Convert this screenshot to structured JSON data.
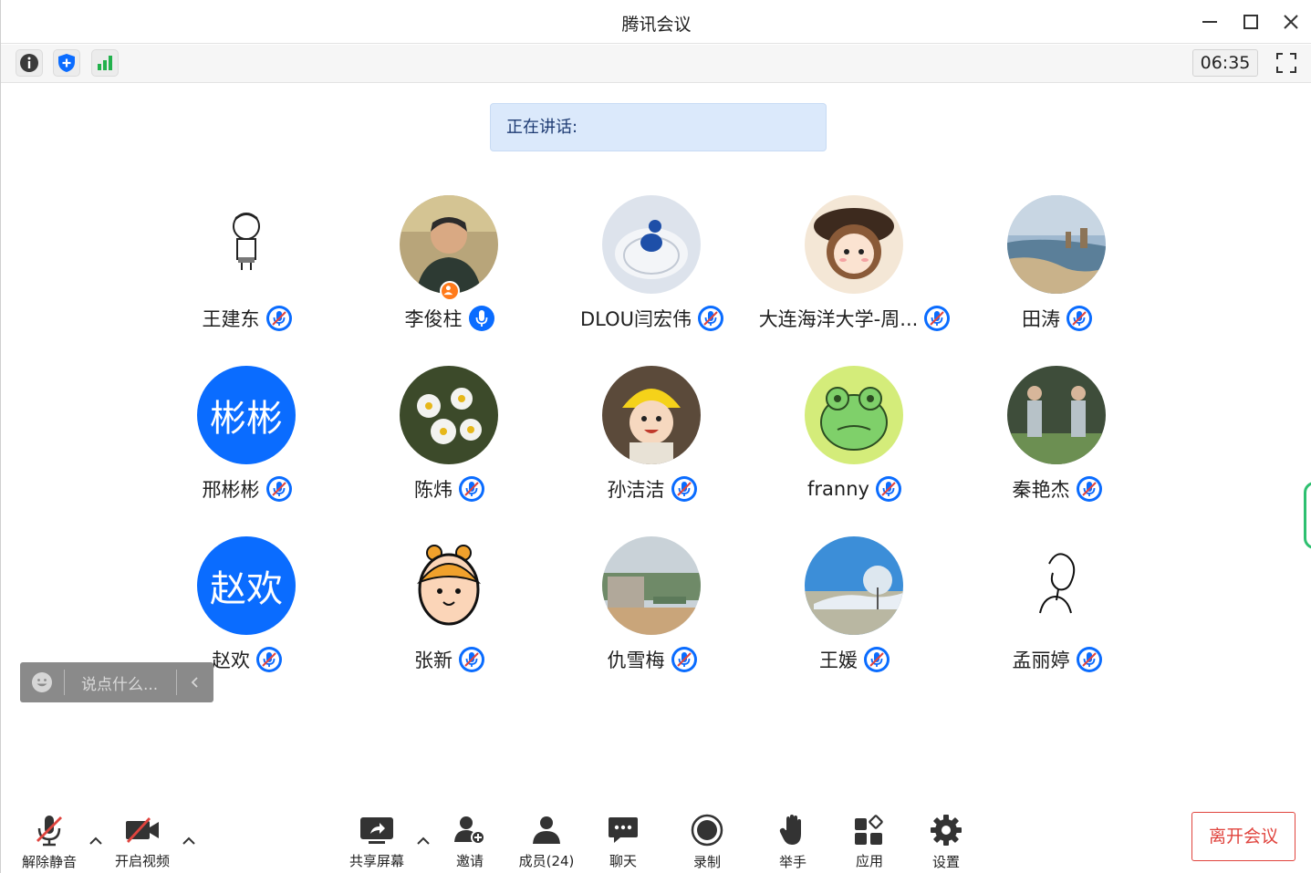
{
  "window": {
    "title": "腾讯会议"
  },
  "infobar": {
    "timer": "06:35"
  },
  "speaking": {
    "label": "正在讲话:"
  },
  "participants": [
    {
      "name": "王建东",
      "muted": true
    },
    {
      "name": "李俊柱",
      "muted": false,
      "host": true
    },
    {
      "name": "DLOU闫宏伟",
      "muted": true
    },
    {
      "name": "大连海洋大学-周...",
      "muted": true
    },
    {
      "name": "田涛",
      "muted": true
    },
    {
      "name": "邢彬彬",
      "muted": true,
      "avatar_text": "彬彬"
    },
    {
      "name": "陈炜",
      "muted": true
    },
    {
      "name": "孙洁洁",
      "muted": true
    },
    {
      "name": "franny",
      "muted": true
    },
    {
      "name": "秦艳杰",
      "muted": true
    },
    {
      "name": "赵欢",
      "muted": true,
      "avatar_text": "赵欢"
    },
    {
      "name": "张新",
      "muted": true
    },
    {
      "name": "仇雪梅",
      "muted": true
    },
    {
      "name": "王媛",
      "muted": true
    },
    {
      "name": "孟丽婷",
      "muted": true
    }
  ],
  "chat": {
    "placeholder": "说点什么..."
  },
  "toolbar": {
    "unmute": "解除静音",
    "start_video": "开启视频",
    "share_screen": "共享屏幕",
    "invite": "邀请",
    "members": "成员(24)",
    "chat": "聊天",
    "record": "录制",
    "raise_hand": "举手",
    "apps": "应用",
    "settings": "设置",
    "leave": "离开会议"
  },
  "colors": {
    "accent": "#0a6cff",
    "leave": "#e0443e",
    "banner": "#dbe9fb"
  }
}
